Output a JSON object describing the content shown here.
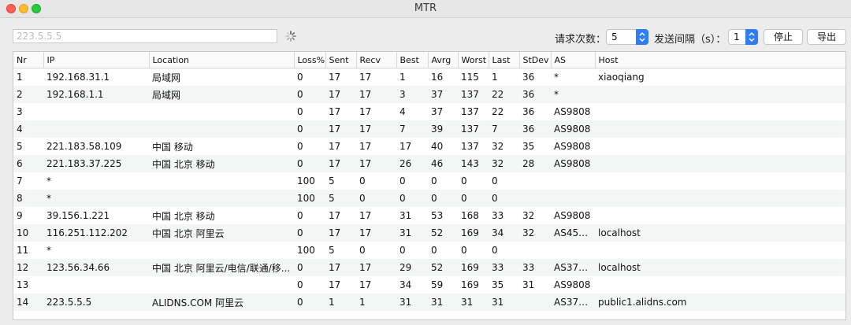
{
  "window": {
    "title": "MTR"
  },
  "toolbar": {
    "target_value": "223.5.5.5",
    "count_label": "请求次数：",
    "count_value": "5",
    "interval_label": "发送间隔（s）：",
    "interval_value": "1",
    "stop_label": "停止",
    "export_label": "导出"
  },
  "table": {
    "columns": [
      "Nr",
      "IP",
      "Location",
      "Loss%",
      "Sent",
      "Recv",
      "Best",
      "Avrg",
      "Worst",
      "Last",
      "StDev",
      "AS",
      "Host"
    ],
    "rows": [
      [
        "1",
        "192.168.31.1",
        "局域网",
        "0",
        "17",
        "17",
        "1",
        "16",
        "115",
        "1",
        "36",
        "*",
        "xiaoqiang"
      ],
      [
        "2",
        "192.168.1.1",
        "局域网",
        "0",
        "17",
        "17",
        "3",
        "37",
        "137",
        "22",
        "36",
        "*",
        ""
      ],
      [
        "3",
        "",
        "",
        "0",
        "17",
        "17",
        "4",
        "37",
        "137",
        "22",
        "36",
        "AS9808",
        ""
      ],
      [
        "4",
        "",
        "",
        "0",
        "17",
        "17",
        "7",
        "39",
        "137",
        "7",
        "36",
        "AS9808",
        ""
      ],
      [
        "5",
        "221.183.58.109",
        "中国 移动",
        "0",
        "17",
        "17",
        "17",
        "40",
        "137",
        "32",
        "35",
        "AS9808",
        ""
      ],
      [
        "6",
        "221.183.37.225",
        "中国 北京 移动",
        "0",
        "17",
        "17",
        "26",
        "46",
        "143",
        "32",
        "28",
        "AS9808",
        ""
      ],
      [
        "7",
        "*",
        "",
        "100",
        "5",
        "0",
        "0",
        "0",
        "0",
        "0",
        "",
        "",
        ""
      ],
      [
        "8",
        "*",
        "",
        "100",
        "5",
        "0",
        "0",
        "0",
        "0",
        "0",
        "",
        "",
        ""
      ],
      [
        "9",
        "39.156.1.221",
        "中国 北京 移动",
        "0",
        "17",
        "17",
        "31",
        "53",
        "168",
        "33",
        "32",
        "AS9808",
        ""
      ],
      [
        "10",
        "116.251.112.202",
        "中国 北京 阿里云",
        "0",
        "17",
        "17",
        "31",
        "52",
        "169",
        "34",
        "32",
        "AS451...",
        "localhost"
      ],
      [
        "11",
        "*",
        "",
        "100",
        "5",
        "0",
        "0",
        "0",
        "0",
        "0",
        "",
        "",
        ""
      ],
      [
        "12",
        "123.56.34.66",
        "中国 北京 阿里云/电信/联通/移...",
        "0",
        "17",
        "17",
        "29",
        "52",
        "169",
        "33",
        "33",
        "AS379...",
        "localhost"
      ],
      [
        "13",
        "",
        "",
        "0",
        "17",
        "17",
        "34",
        "59",
        "169",
        "35",
        "31",
        "AS9808",
        ""
      ],
      [
        "14",
        "223.5.5.5",
        "ALIDNS.COM 阿里云",
        "0",
        "1",
        "1",
        "31",
        "31",
        "31",
        "31",
        "",
        "AS379...",
        "public1.alidns.com"
      ]
    ]
  }
}
